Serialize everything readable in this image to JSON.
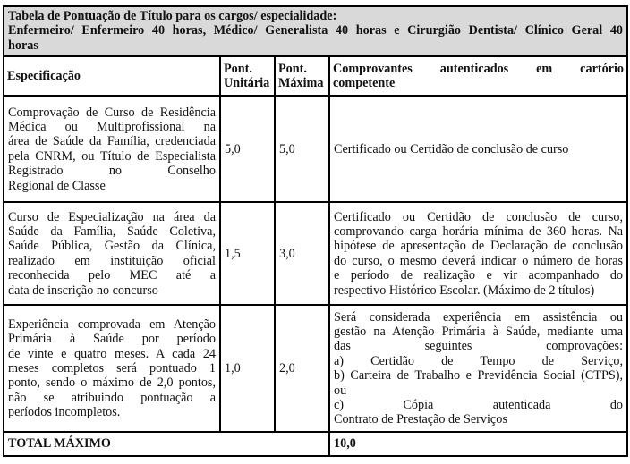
{
  "document": {
    "title_line1": "Tabela de Pontuação de Título para os cargos/ especialidade:",
    "title_line2": "Enfermeiro/ Enfermeiro 40 horas, Médico/ Generalista 40 horas e Cirurgião Dentista/ Clínico Geral 40",
    "title_line3": "horas",
    "header_color": "#d9d9d9"
  },
  "table": {
    "headers": {
      "spec": "Especificação",
      "unit_line1": "Pont.",
      "unit_line2": "Unitária",
      "max_line1": "Pont.",
      "max_line2": "Máxima",
      "proof_line1": "Comprovantes autenticados em cartório",
      "proof_line2": "competente"
    },
    "rows": [
      {
        "spec_lines": [
          "Comprovação de Curso de Residência",
          "Médica ou Multiprofissional na",
          "área de Saúde da Família, credenciada",
          "pela CNRM, ou Título de Especialista",
          "Registrado no Conselho",
          "Regional de Classe"
        ],
        "unit": "5,0",
        "max": "5,0",
        "proof_lines": [
          "Certificado ou Certidão de conclusão de curso"
        ]
      },
      {
        "spec_lines": [
          "Curso de Especialização na área da",
          "Saúde da Família, Saúde Coletiva,",
          "Saúde Pública, Gestão da Clínica,",
          "realizado em instituição oficial",
          "reconhecida pelo MEC até a",
          "data de inscrição no concurso"
        ],
        "unit": "1,5",
        "max": "3,0",
        "proof_lines": [
          "Certificado ou Certidão de conclusão de curso,",
          "comprovando carga horária mínima de 360 horas. Na",
          "hipótese de apresentação de Declaração de conclusão",
          "do curso, o mesmo deverá indicar o número de horas",
          "e período de realização e vir acompanhado do",
          "respectivo Histórico Escolar. (Máximo de 2 títulos)"
        ]
      },
      {
        "spec_lines": [
          "Experiência comprovada em Atenção",
          "Primária à Saúde por período",
          "de vinte e quatro meses. A cada 24",
          "meses completos será pontuado 1",
          "ponto, sendo o máximo de 2,0 pontos,",
          "não se atribuindo pontuação a",
          "períodos incompletos."
        ],
        "unit": "1,0",
        "max": "2,0",
        "proof_lines": [
          "Será considerada experiência em assistência ou",
          "gestão na Atenção Primária à Saúde, mediante uma",
          "das seguintes comprovações:",
          "a) Certidão de Tempo de Serviço,",
          "b) Carteira de Trabalho e Previdência Social (CTPS),",
          "ou",
          "c) Cópia autenticada do",
          "Contrato de Prestação de Serviços"
        ]
      }
    ],
    "total": {
      "label": "TOTAL MÁXIMO",
      "value": "10,0"
    }
  }
}
